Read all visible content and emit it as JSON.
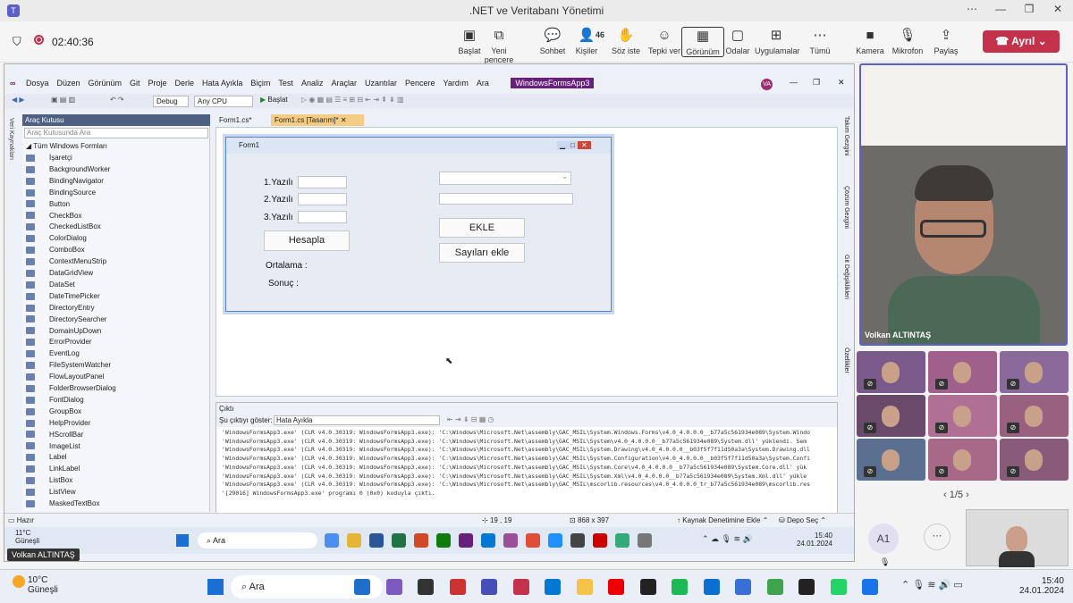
{
  "teams": {
    "window_title": ".NET ve Veritabanı Yönetimi",
    "timer": "02:40:36",
    "toolbar": [
      {
        "label": "Başlat",
        "icon": "screen-share-icon"
      },
      {
        "label": "Yeni pencere",
        "icon": "new-window-icon"
      },
      {
        "label": "Sohbet",
        "icon": "chat-icon"
      },
      {
        "label": "Kişiler",
        "icon": "people-icon",
        "badge": "46"
      },
      {
        "label": "Söz iste",
        "icon": "raise-hand-icon"
      },
      {
        "label": "Tepki ver",
        "icon": "smile-icon"
      },
      {
        "label": "Görünüm",
        "icon": "grid-icon"
      },
      {
        "label": "Odalar",
        "icon": "rooms-icon"
      },
      {
        "label": "Uygulamalar",
        "icon": "plus-icon"
      },
      {
        "label": "Tümü",
        "icon": "more-icon"
      },
      {
        "label": "Kamera",
        "icon": "camera-icon"
      },
      {
        "label": "Mikrofon",
        "icon": "mic-off-icon"
      },
      {
        "label": "Paylaş",
        "icon": "share-icon"
      }
    ],
    "leave_label": "Ayrıl",
    "presenter_name": "Volkan ALTINTAŞ",
    "pager": "1/5",
    "self_initials": "A1"
  },
  "vs": {
    "menu": [
      "Dosya",
      "Düzen",
      "Görünüm",
      "Git",
      "Proje",
      "Derle",
      "Hata Ayıkla",
      "Biçim",
      "Test",
      "Analiz",
      "Araçlar",
      "Uzantılar",
      "Pencere",
      "Yardım",
      "Ara"
    ],
    "solution_badge": "WindowsFormsApp3",
    "user_initials": "VA",
    "config": "Debug",
    "platform": "Any CPU",
    "start_label": "Başlat",
    "toolbox_title": "Araç Kutusu",
    "toolbox_search": "Araç Kutusunda Ara",
    "toolbox_group": "Tüm Windows Formları",
    "toolbox_items": [
      "İşaretçi",
      "BackgroundWorker",
      "BindingNavigator",
      "BindingSource",
      "Button",
      "CheckBox",
      "CheckedListBox",
      "ColorDialog",
      "ComboBox",
      "ContextMenuStrip",
      "DataGridView",
      "DataSet",
      "DateTimePicker",
      "DirectoryEntry",
      "DirectorySearcher",
      "DomainUpDown",
      "ErrorProvider",
      "EventLog",
      "FileSystemWatcher",
      "FlowLayoutPanel",
      "FolderBrowserDialog",
      "FontDialog",
      "GroupBox",
      "HelpProvider",
      "HScrollBar",
      "ImageList",
      "Label",
      "LinkLabel",
      "ListBox",
      "ListView",
      "MaskedTextBox"
    ],
    "left_side_label": "Veri Kaynakları",
    "tabs": [
      "Form1.cs*",
      "Form1.cs [Tasarım]*"
    ],
    "form": {
      "title": "Form1",
      "label1": "1.Yazılı",
      "label2": "2.Yazılı",
      "label3": "3.Yazılı",
      "calc_button": "Hesapla",
      "avg_label": "Ortalama :",
      "result_label": "Sonuç :",
      "add_button": "EKLE",
      "add_numbers_button": "Sayıları ekle"
    },
    "output": {
      "title": "Çıktı",
      "show_label": "Şu çıktıyı göster:",
      "source": "Hata Ayıkla",
      "lines": [
        "'WindowsFormsApp3.exe' (CLR v4.0.30319: WindowsFormsApp3.exe): 'C:\\Windows\\Microsoft.Net\\assembly\\GAC_MSIL\\System.Windows.Forms\\v4.0_4.0.0.0__b77a5c561934e089\\System.Windo",
        "'WindowsFormsApp3.exe' (CLR v4.0.30319: WindowsFormsApp3.exe): 'C:\\Windows\\Microsoft.Net\\assembly\\GAC_MSIL\\System\\v4.0_4.0.0.0__b77a5c561934e089\\System.dll' yüklendi. Sem",
        "'WindowsFormsApp3.exe' (CLR v4.0.30319: WindowsFormsApp3.exe): 'C:\\Windows\\Microsoft.Net\\assembly\\GAC_MSIL\\System.Drawing\\v4.0_4.0.0.0__b03f5f7f11d50a3a\\System.Drawing.dll",
        "'WindowsFormsApp3.exe' (CLR v4.0.30319: WindowsFormsApp3.exe): 'C:\\Windows\\Microsoft.Net\\assembly\\GAC_MSIL\\System.Configuration\\v4.0_4.0.0.0__b03f5f7f11d50a3a\\System.Confi",
        "'WindowsFormsApp3.exe' (CLR v4.0.30319: WindowsFormsApp3.exe): 'C:\\Windows\\Microsoft.Net\\assembly\\GAC_MSIL\\System.Core\\v4.0_4.0.0.0__b77a5c561934e089\\System.Core.dll' yük",
        "'WindowsFormsApp3.exe' (CLR v4.0.30319: WindowsFormsApp3.exe): 'C:\\Windows\\Microsoft.Net\\assembly\\GAC_MSIL\\System.Xml\\v4.0_4.0.0.0__b77a5c561934e089\\System.Xml.dll' yükle",
        "'WindowsFormsApp3.exe' (CLR v4.0.30319: WindowsFormsApp3.exe): 'C:\\Windows\\Microsoft.Net\\assembly\\GAC_MSIL\\mscorlib.resources\\v4.0_4.0.0.0_tr_b77a5c561934e089\\mscorlib.res",
        "'[29016] WindowsFormsApp3.exe' programı 0 (0x0) koduyla çıktı."
      ]
    },
    "right_side": [
      "Takım Gezgini",
      "Çözüm Gezgini",
      "Git Değişiklikleri",
      "Özellikler"
    ],
    "status": {
      "ready": "Hazır",
      "position": "19 , 19",
      "size": "868 x 397",
      "source_control": "Kaynak Denetimine Ekle",
      "repo": "Depo Seç"
    },
    "inner_weather": "11°C",
    "inner_weather_sub": "Güneşli",
    "inner_time": "15:40",
    "inner_date": "24.01.2024",
    "inner_search": "Ara"
  },
  "windows": {
    "weather_temp": "10°C",
    "weather_desc": "Güneşli",
    "search": "Ara",
    "time": "15:40",
    "date": "24.01.2024"
  },
  "colors": {
    "teams_accent": "#5b5fc7",
    "leave": "#c4314b",
    "vs_accent": "#68217a"
  }
}
